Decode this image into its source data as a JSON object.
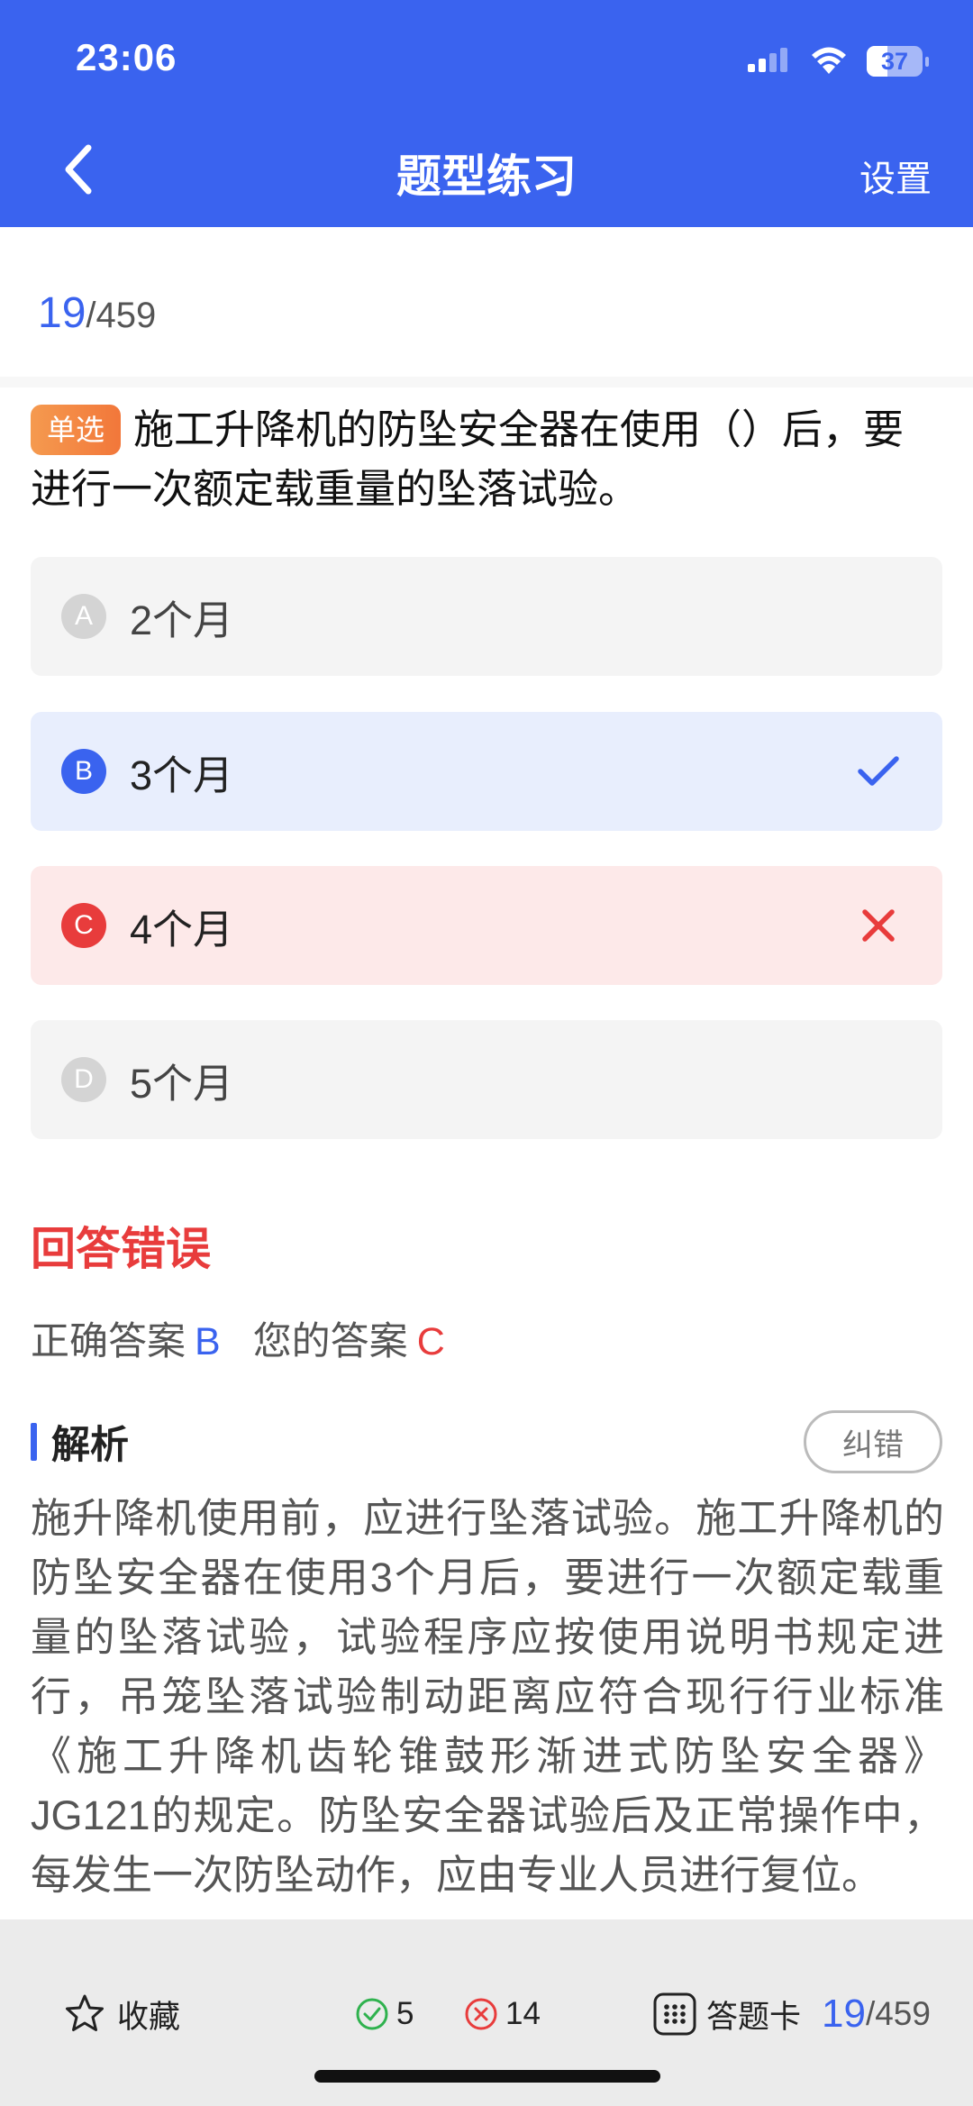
{
  "status_bar": {
    "time": "23:06",
    "battery": "37"
  },
  "nav": {
    "title": "题型练习",
    "settings_label": "设置"
  },
  "progress": {
    "current": "19",
    "total": "/459"
  },
  "question": {
    "type_badge": "单选",
    "text": "施工升降机的防坠安全器在使用（）后，要进行一次额定载重量的坠落试验。"
  },
  "options": [
    {
      "letter": "A",
      "text": "2个月",
      "state": "normal"
    },
    {
      "letter": "B",
      "text": "3个月",
      "state": "correct"
    },
    {
      "letter": "C",
      "text": "4个月",
      "state": "wrong"
    },
    {
      "letter": "D",
      "text": "5个月",
      "state": "normal"
    }
  ],
  "result": {
    "title": "回答错误",
    "correct_label": "正确答案",
    "correct_value": "B",
    "your_label": "您的答案",
    "your_value": "C"
  },
  "analysis": {
    "title": "解析",
    "report_button": "纠错",
    "text": "施升降机使用前，应进行坠落试验。施工升降机的防坠安全器在使用3个月后，要进行一次额定载重量的坠落试验，试验程序应按使用说明书规定进行，吊笼坠落试验制动距离应符合现行行业标准《施工升降机齿轮锥鼓形渐进式防坠安全器》JG121的规定。防坠安全器试验后及正常操作中，每发生一次防坠动作，应由专业人员进行复位。"
  },
  "bottom_bar": {
    "favorite_label": "收藏",
    "correct_count": "5",
    "wrong_count": "14",
    "answer_card_label": "答题卡",
    "progress_current": "19",
    "progress_total": "/459"
  },
  "colors": {
    "primary": "#3a63ef",
    "error": "#e83c3c",
    "success": "#2fb24e",
    "badge_orange": "#f2773a"
  }
}
